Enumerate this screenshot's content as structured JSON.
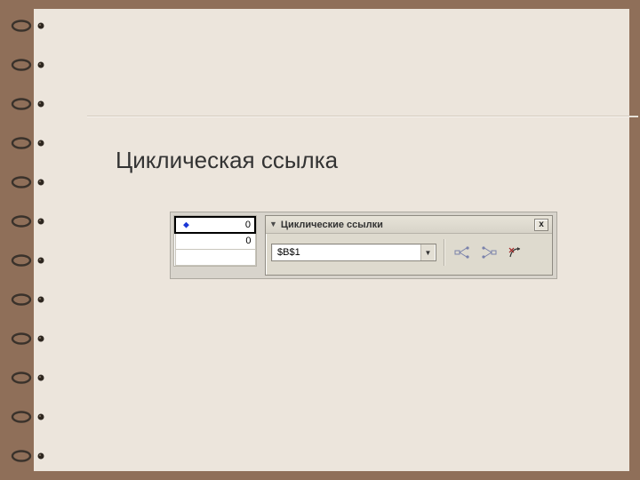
{
  "slide": {
    "title": "Циклическая ссылка"
  },
  "cells": {
    "rows": [
      {
        "value": "0",
        "selected": true,
        "marker": true
      },
      {
        "value": "0",
        "selected": false,
        "marker": false
      },
      {
        "value": "",
        "selected": false,
        "marker": false
      }
    ]
  },
  "toolbar": {
    "title": "Циклические ссылки",
    "close": "x",
    "combo_value": "$B$1",
    "icons": {
      "trace_precedents": "trace-precedents-icon",
      "trace_dependents": "trace-dependents-icon",
      "remove_arrows": "remove-arrows-icon"
    }
  }
}
